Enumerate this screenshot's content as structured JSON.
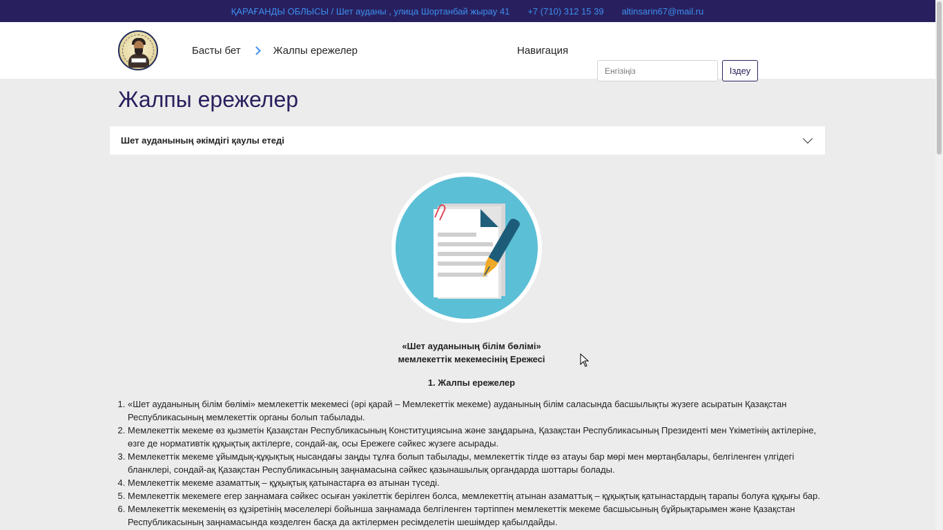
{
  "topbar": {
    "address": "ҚАРАҒАНДЫ ОБЛЫСЫ / Шет ауданы , улица Шортанбай жырау 41",
    "phone": "+7 (710) 312 15 39",
    "email": "altinsarin67@mail.ru"
  },
  "header": {
    "breadcrumb": {
      "home": "Басты бет",
      "current": "Жалпы ережелер"
    },
    "nav_label": "Навигация",
    "search": {
      "placeholder": "Енгізіңіз",
      "button_label": "Іздеу"
    }
  },
  "main": {
    "title": "Жалпы ережелер",
    "accordion_label": "Шет ауданының әкімдігі қаулы етеді",
    "document_title_line1": "«Шет ауданының білім бөлімі»",
    "document_title_line2": "мемлекеттік мекемесінің Ережесі",
    "section_heading": "1. Жалпы ережелер",
    "rules": [
      "«Шет ауданының білім бөлімі» мемлекеттік мекемесі (әрі қарай – Мемлекеттік мекеме) ауданының білім саласында басшылықты жүзеге асыратын Қазақстан Республикасының мемлекеттік органы болып табылады.",
      "Мемлекеттік мекеме өз қызметін Қазақстан Республикасының Конституциясына және заңдарына, Қазақстан Республикасының Президенті мен Үкіметінің актілеріне, өзге де нормативтік құқықтық актілерге, сондай-ақ, осы Ережеге сәйкес жүзеге асырады.",
      "Мемлекеттік мекеме ұйымдық-құқықтық нысандағы заңды тұлға болып табылады, мемлекеттік тілде өз атауы бар мөрі мен мөртаңбалары, белгіленген үлгідегі бланклері, сондай-ақ Қазақстан Республикасының заңнамасына сәйкес қазынашылық органдарда шоттары болады.",
      "Мемлекеттік мекеме азаматтық – құқықтық қатынастарға өз атынан түседі.",
      "Мемлекеттік мекемеге егер заңнамаға сәйкес осыған уәкілеттік берілген болса, мемлекеттің атынан азаматтық – құқықтық қатынастардың тарапы болуға құқығы бар.",
      "Мемлекеттік мекеменің өз құзіретінің мәселелері бойынша заңнамада белгіленген тәртіппен мемлекеттік мекеме басшысының бұйрықтарымен және Қазақстан Республикасының заңнамасында көзделген басқа да актілермен ресімделетін шешімдер қабылдайды."
    ]
  }
}
